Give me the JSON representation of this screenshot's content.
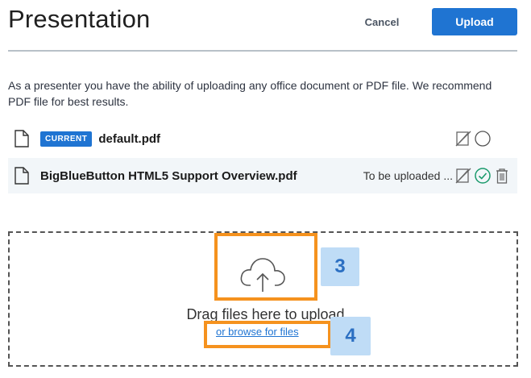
{
  "header": {
    "title": "Presentation",
    "cancel_label": "Cancel",
    "upload_label": "Upload"
  },
  "description": "As a presenter you have the ability of uploading any office document or PDF file. We recommend PDF file for best results.",
  "files": [
    {
      "badge": "CURRENT",
      "name": "default.pdf",
      "status": ""
    },
    {
      "badge": "",
      "name": "BigBlueButton HTML5 Support Overview.pdf",
      "status": "To be uploaded ..."
    }
  ],
  "dropzone": {
    "drag_text": "Drag files here to upload",
    "browse_text": "or browse for files"
  },
  "annotations": {
    "step3": "3",
    "step4": "4"
  },
  "colors": {
    "accent": "#1f74d2",
    "highlight": "#f5921e",
    "success": "#1a9a6c"
  },
  "icons": [
    "file-icon",
    "annotate-disabled-icon",
    "radio-icon",
    "check-circle-icon",
    "trash-icon",
    "cloud-upload-icon"
  ]
}
